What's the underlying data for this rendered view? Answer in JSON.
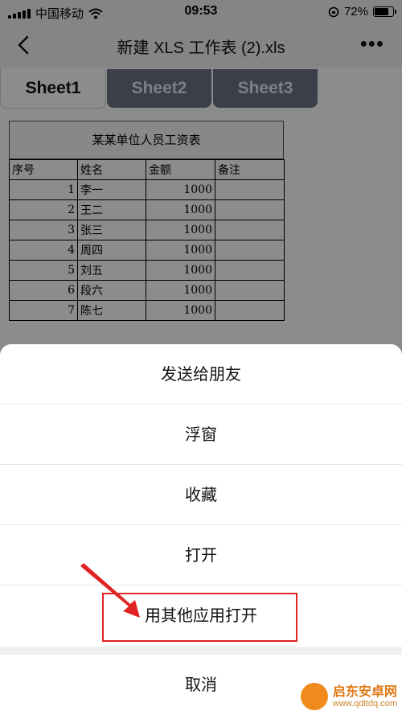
{
  "status_bar": {
    "carrier": "中国移动",
    "time": "09:53",
    "battery": "72%"
  },
  "nav": {
    "title": "新建 XLS 工作表 (2).xls"
  },
  "tabs": [
    {
      "label": "Sheet1",
      "active": true
    },
    {
      "label": "Sheet2",
      "active": false
    },
    {
      "label": "Sheet3",
      "active": false
    }
  ],
  "table": {
    "title": "某某单位人员工资表",
    "headers": [
      "序号",
      "姓名",
      "金额",
      "备注"
    ],
    "rows": [
      [
        "1",
        "李一",
        "1000",
        ""
      ],
      [
        "2",
        "王二",
        "1000",
        ""
      ],
      [
        "3",
        "张三",
        "1000",
        ""
      ],
      [
        "4",
        "周四",
        "1000",
        ""
      ],
      [
        "5",
        "刘五",
        "1000",
        ""
      ],
      [
        "6",
        "段六",
        "1000",
        ""
      ],
      [
        "7",
        "陈七",
        "1000",
        ""
      ]
    ]
  },
  "action_sheet": {
    "items": [
      "发送给朋友",
      "浮窗",
      "收藏",
      "打开",
      "用其他应用打开"
    ],
    "cancel": "取消"
  },
  "watermark": {
    "name": "启东安卓网",
    "url": "www.qdltdq.com"
  },
  "colors": {
    "highlight": "#e02424",
    "tab_inactive": "#6b7388"
  }
}
